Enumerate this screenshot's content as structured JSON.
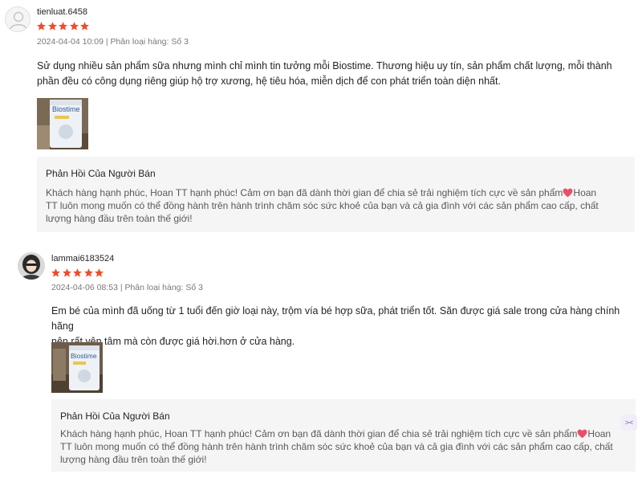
{
  "reviews": [
    {
      "username": "tienluat.6458",
      "rating": 5,
      "meta": "2024-04-04 10:09 | Phân loại hàng: Số 3",
      "content_line1": "Sử dụng nhiều sản phẩm sữa nhưng mình chỉ mình tin tưởng mỗi Biostime. Thương hiệu uy tín, sản phẩm chất lượng, mỗi thành",
      "content_line2": "phần đều có công dụng riêng giúp hộ trợ xương, hệ tiêu hóa, miễn dịch để con phát triển toàn diện nhất.",
      "product_image_text": "Biostime",
      "seller_reply_title": "Phản Hồi Của Người Bán",
      "seller_reply_line1": "Khách hàng hạnh phúc, Hoan TT hạnh phúc! Cảm ơn bạn đã dành thời gian để chia sẻ trải nghiệm tích cực về sản phẩm",
      "seller_reply_line1_tail": "Hoan",
      "seller_reply_line2": "TT luôn mong muốn có thể đồng hành trên hành trình chăm sóc sức khoẻ của bạn và cả gia đình với các sản phẩm cao cấp, chất",
      "seller_reply_line3": "lượng hàng đầu trên toàn thế giới!"
    },
    {
      "username": "lammai6183524",
      "rating": 5,
      "meta": "2024-04-06 08:53 | Phân loại hàng: Số 3",
      "content_line1": "Em bé của mình đã uống từ 1 tuổi đến giờ loại này, trộm vía bé hợp sữa, phát triển tốt. Săn được giá sale trong cửa hàng chính hãng",
      "content_line2": "nên rất yên tâm mà còn được giá hời.hơn ở cửa hàng.",
      "product_image_text": "Biostime",
      "seller_reply_title": "Phản Hồi Của Người Bán",
      "seller_reply_line1": "Khách hàng hạnh phúc, Hoan TT hạnh phúc! Cảm ơn bạn đã dành thời gian để chia sẻ trải nghiệm tích cực về sản phẩm",
      "seller_reply_line1_tail": "Hoan",
      "seller_reply_line2": "TT luôn mong muốn có thể đồng hành trên hành trình chăm sóc sức khoẻ của bạn và cả gia đình với các sản phẩm cao cấp, chất",
      "seller_reply_line3": "lượng hàng đầu trên toàn thế giới!"
    }
  ],
  "side_widget": {
    "icon": "collapse-arrows-icon",
    "glyph": "><"
  },
  "colors": {
    "star": "#ee4d2d",
    "heart": "#e94f6a",
    "reply_bg": "#f5f5f5"
  }
}
